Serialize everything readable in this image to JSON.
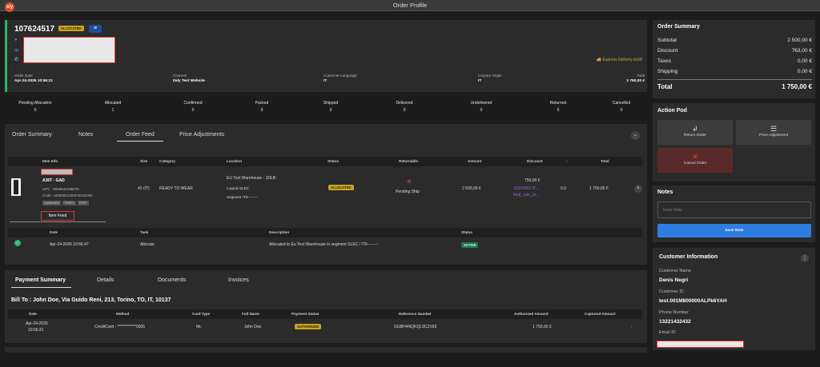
{
  "app": {
    "title": "Order Profile",
    "logo": "x/y"
  },
  "order": {
    "id": "107624517",
    "status": "ALLOCATED",
    "delivery": "Express Delivery EUR",
    "info": [
      {
        "label": "Order Date",
        "value": "Apr-24-2026 10:56:21"
      },
      {
        "label": "Channel",
        "value": "Italy Test Website"
      },
      {
        "label": "Customer Language",
        "value": "IT"
      },
      {
        "label": "Country Origin",
        "value": "IT"
      },
      {
        "label": "Total",
        "value": "1 750,00 €"
      }
    ]
  },
  "counts": [
    {
      "label": "Pending Allocation",
      "value": "0"
    },
    {
      "label": "Allocated",
      "value": "1"
    },
    {
      "label": "Confirmed",
      "value": "0"
    },
    {
      "label": "Packed",
      "value": "0"
    },
    {
      "label": "Shipped",
      "value": "0"
    },
    {
      "label": "Delivered",
      "value": "0"
    },
    {
      "label": "Undelivered",
      "value": "0"
    },
    {
      "label": "Returned",
      "value": "0"
    },
    {
      "label": "Cancelled",
      "value": "0"
    }
  ],
  "tabs": [
    "Order Summary",
    "Notes",
    "Order Feed",
    "Price Adjustments"
  ],
  "items_table": {
    "headers": [
      "Item Info",
      "Size",
      "Category",
      "Location",
      "Status",
      "Returnable",
      "Amount",
      "Discount",
      "-",
      "Total"
    ],
    "item": {
      "name": "A36T - GAD",
      "upc": "UPC : 8056642198276",
      "code": "Code : M000001402P2D1D001",
      "tags": [
        "DAMAGED",
        "TEMP1",
        "FEST"
      ],
      "size": "42 (IT)",
      "category": "READY TO WEAR",
      "location": "EU Test Warehouse - 1DLB",
      "logical": "Logical SLEC",
      "segment": "Segment IT0--------",
      "status": "ALLOCATED",
      "returnable": "Pending Ship",
      "amount": "2 500,00 €",
      "discount": "750,00 €",
      "discount_code": "20250901-IT...",
      "discount_name": "final_sale_pr...",
      "zero": "0,0",
      "total": "1 750,00 €"
    }
  },
  "item_feed": {
    "tab": "Item Feed",
    "headers": [
      "Date",
      "Task",
      "Description",
      "Status"
    ],
    "row": {
      "date": "Apr-24-2026 10:56:47",
      "task": "Allocate",
      "description": "Allocated to Eu Test Warehouse in segment SLEC / IT0--------",
      "status": "ACTIVE"
    }
  },
  "payment_tabs": [
    "Payment Summary",
    "Details",
    "Documents",
    "Invoices"
  ],
  "bill_to": "Bill To : John Doe, Via Guido Reni, 213, Torino, TO, IT, 10137",
  "payment_table": {
    "headers": [
      "Date",
      "Method",
      "Card Type",
      "Full Name",
      "Payment Status",
      "Reference Number",
      "Authorised Amount",
      "Captured Amount"
    ],
    "row": {
      "date": "Apr-24-2026",
      "time": "10:56:21",
      "method": "CreditCard - ************0005",
      "card": "Mc",
      "name": "John Doe",
      "status": "AUTHORIZED",
      "ref": "GGBH4NQKQL9CZX65",
      "auth": "1 750,00 €",
      "captured": "-"
    }
  },
  "summary": {
    "title": "Order Summary",
    "rows": [
      {
        "label": "Subtotal",
        "value": "2 500,00 €"
      },
      {
        "label": "Discount",
        "value": "763,00 €"
      },
      {
        "label": "Taxes",
        "value": "0,00 €"
      },
      {
        "label": "Shipping",
        "value": "0,00 €"
      }
    ],
    "total_label": "Total",
    "total_value": "1 750,00 €"
  },
  "action_pod": {
    "title": "Action Pod",
    "return": "Return Order",
    "price": "Price Adjustment",
    "cancel": "Cancel Order"
  },
  "notes": {
    "title": "Notes",
    "placeholder": "Enter Note",
    "save": "Save Note"
  },
  "customer": {
    "title": "Customer Information",
    "name_label": "Customer Name",
    "name": "Denis Negri",
    "id_label": "Customer ID",
    "id": "test.001M800000ALPk6YAH",
    "phone_label": "Phone Number",
    "phone": "13221432432",
    "email_label": "Email ID"
  },
  "colors": {
    "accent": "#2f7de1",
    "badge": "#c8a51f",
    "green": "#2db36a",
    "danger": "#e04040"
  }
}
